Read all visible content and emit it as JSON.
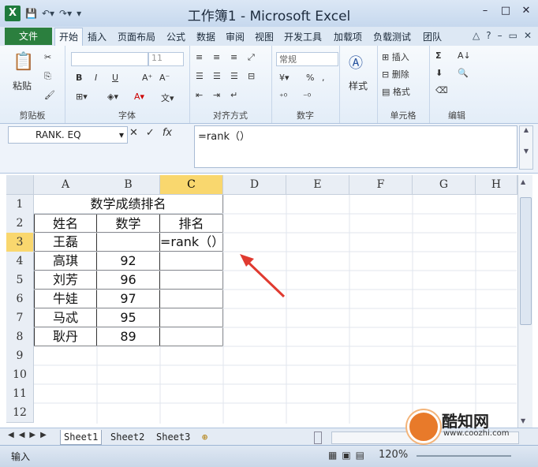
{
  "window": {
    "title": "工作簿1 - Microsoft Excel",
    "logo": "X",
    "buttons": [
      "–",
      "□",
      "✕"
    ]
  },
  "ribbon_tabs": [
    "文件",
    "开始",
    "插入",
    "页面布局",
    "公式",
    "数据",
    "审阅",
    "视图",
    "开发工具",
    "加载项",
    "负载测试",
    "团队"
  ],
  "ribbon": {
    "clipboard": {
      "label": "剪贴板",
      "paste": "粘贴"
    },
    "font": {
      "label": "字体",
      "size": "11",
      "bold": "B",
      "italic": "I",
      "underline": "U"
    },
    "alignment": {
      "label": "对齐方式"
    },
    "number": {
      "label": "数字",
      "format": "常规",
      "percent": "%"
    },
    "styles": {
      "label": "样式"
    },
    "cells": {
      "label": "单元格",
      "insert": "插入",
      "delete": "删除",
      "format": "格式"
    },
    "editing": {
      "label": "编辑",
      "sum": "Σ"
    }
  },
  "formula_bar": {
    "name_box": "RANK. EQ",
    "fx": "fx",
    "formula": "=rank（）"
  },
  "columns": [
    "A",
    "B",
    "C",
    "D",
    "E",
    "F",
    "G",
    "H"
  ],
  "rows": [
    "1",
    "2",
    "3",
    "4",
    "5",
    "6",
    "7",
    "8",
    "9",
    "10",
    "11",
    "12"
  ],
  "cells": {
    "title": "数学成绩排名",
    "header_name": "姓名",
    "header_math": "数学",
    "header_rank": "排名",
    "c3": "=rank（）",
    "students": [
      {
        "name": "王磊",
        "score": ""
      },
      {
        "name": "高琪",
        "score": "92"
      },
      {
        "name": "刘芳",
        "score": "96"
      },
      {
        "name": "牛娃",
        "score": "97"
      },
      {
        "name": "马忒",
        "score": "95"
      },
      {
        "name": "耿丹",
        "score": "89"
      }
    ]
  },
  "sheets": [
    "Sheet1",
    "Sheet2",
    "Sheet3"
  ],
  "status": {
    "mode": "输入",
    "zoom": "120%"
  },
  "watermark": {
    "name": "酷知网",
    "url": "www.coozhi.com"
  },
  "colors": {
    "selection_header": "#f9d76e",
    "file_tab": "#2b7f3e",
    "arrow": "#e03a30"
  }
}
